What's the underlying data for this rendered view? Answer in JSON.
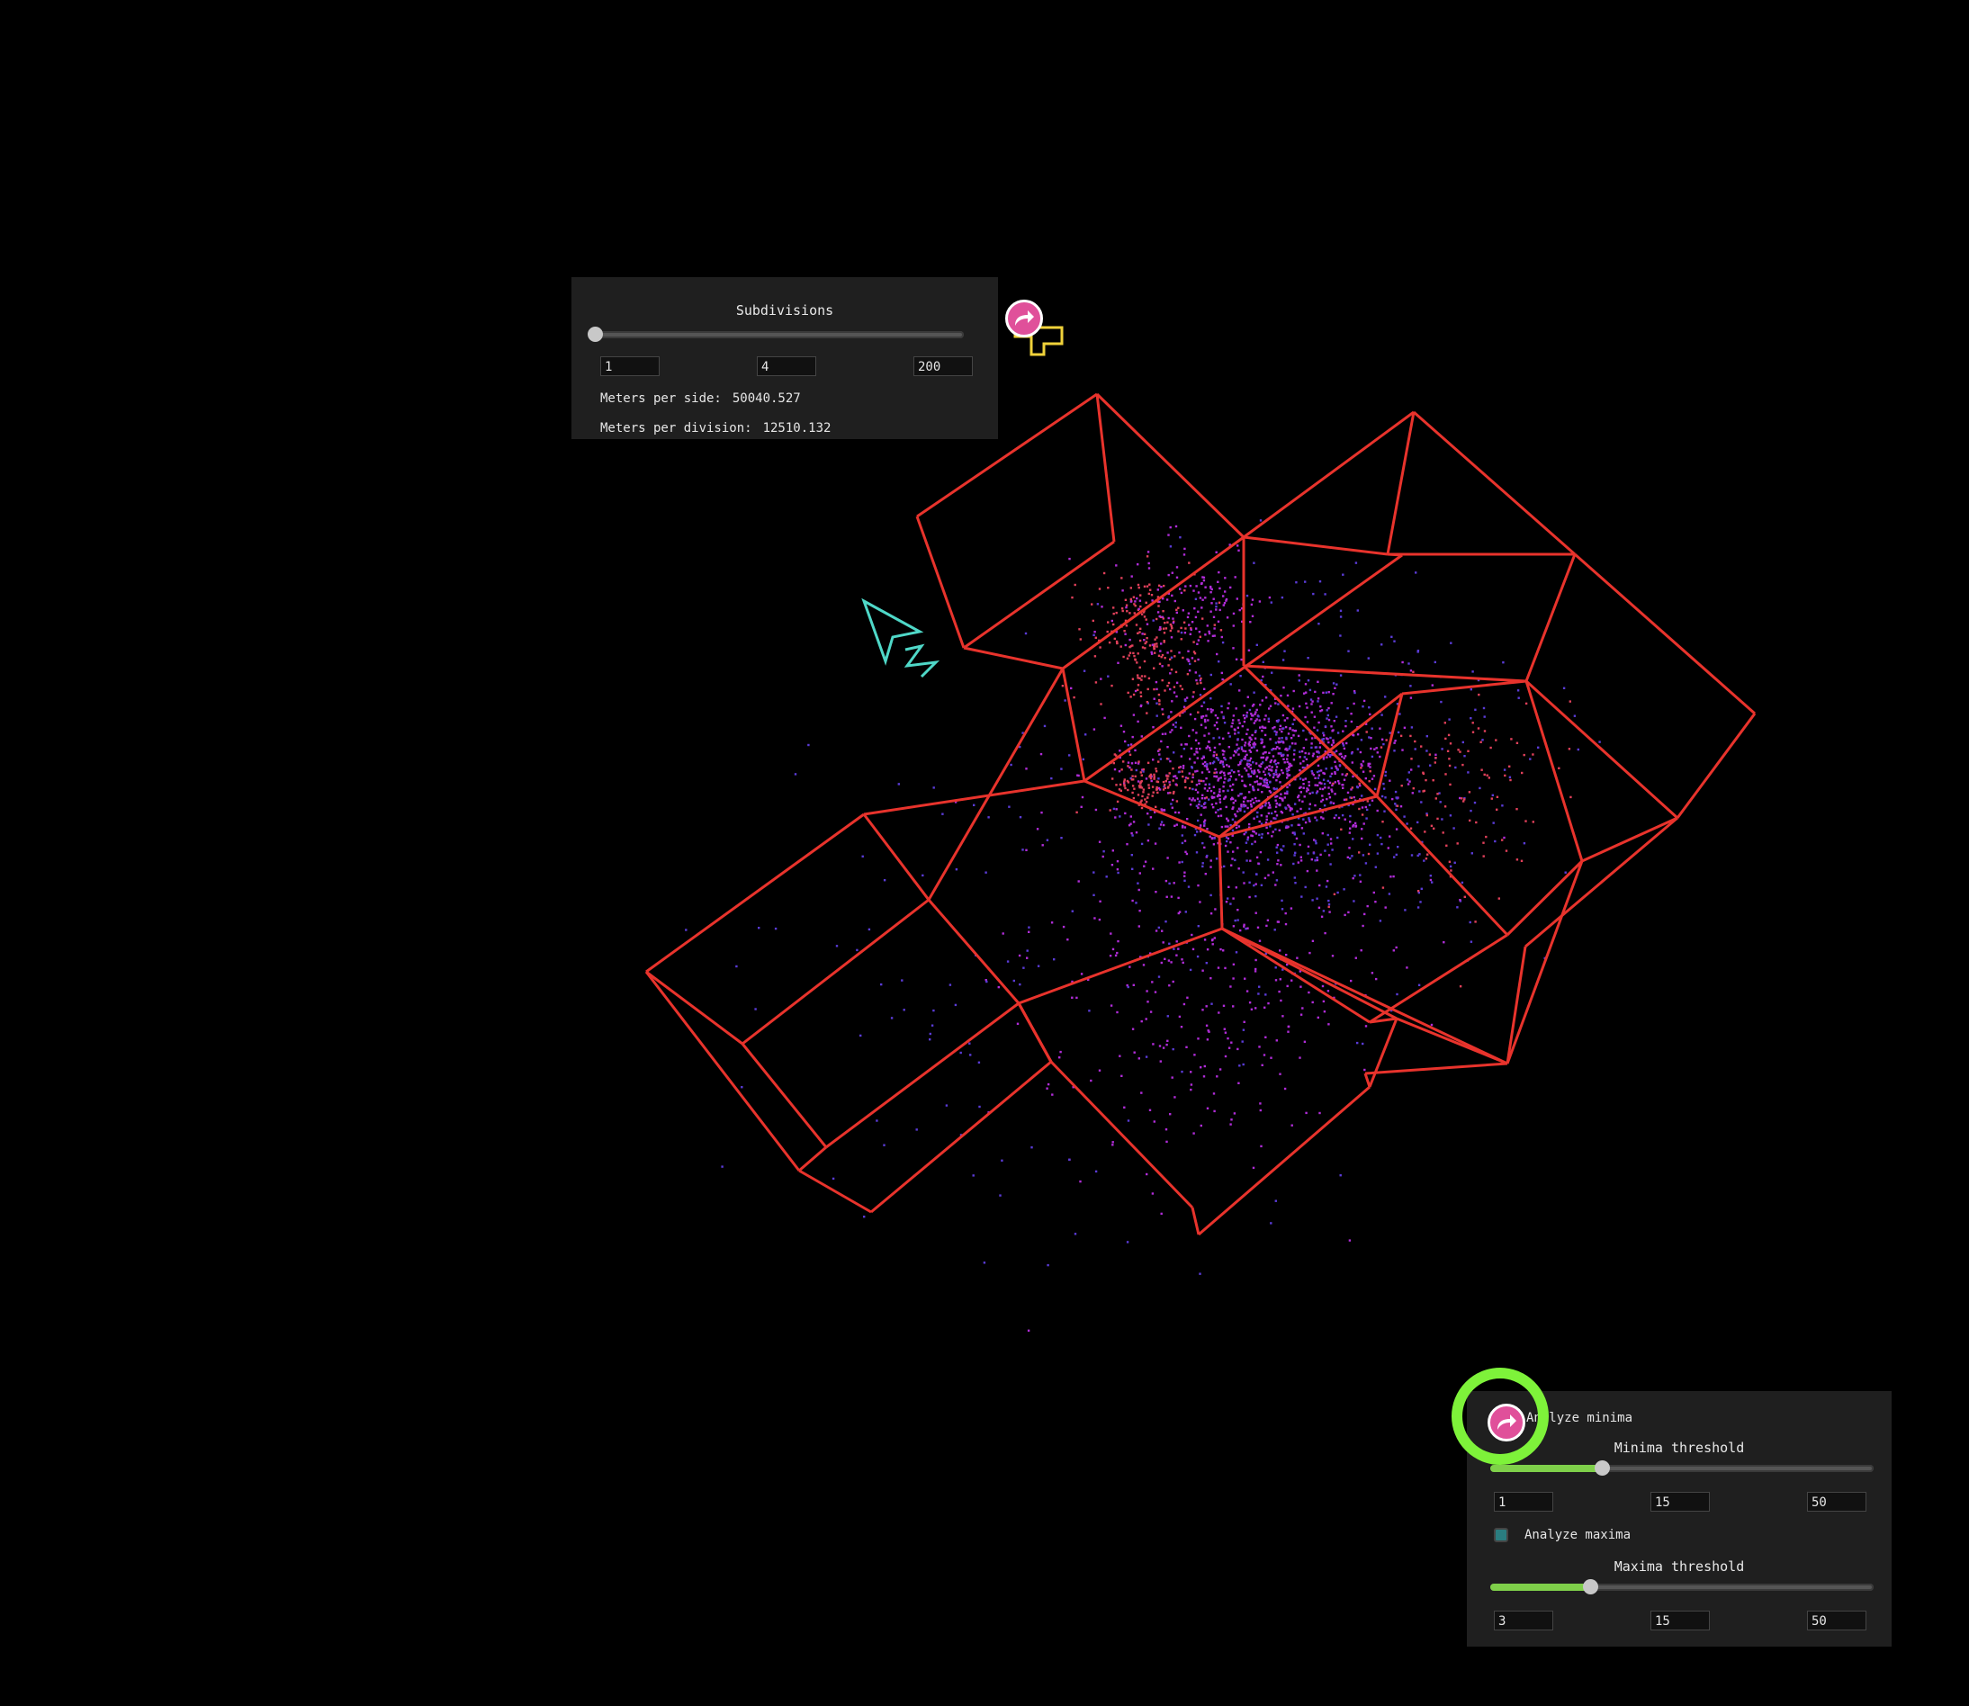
{
  "subdivisions_panel": {
    "title": "Subdivisions",
    "slider_fraction": 0.0,
    "min_value": "1",
    "current_value": "4",
    "max_value": "200",
    "meters_per_side_label": "Meters per side:",
    "meters_per_side_value": "50040.527",
    "meters_per_division_label": "Meters per division:",
    "meters_per_division_value": "12510.132"
  },
  "threshold_panel": {
    "analyze_minima_label": "Analyze minima",
    "minima_threshold_title": "Minima threshold",
    "minima_slider_fraction": 0.29,
    "minima_min": "1",
    "minima_current": "15",
    "minima_max": "50",
    "analyze_maxima_label": "Analyze maxima",
    "maxima_threshold_title": "Maxima threshold",
    "maxima_slider_fraction": 0.26,
    "maxima_min": "3",
    "maxima_current": "15",
    "maxima_max": "50"
  },
  "icons": {
    "redo_badge": "redo-arrow-icon",
    "orientation_gizmo": "north-arrow-icon",
    "cursor": "crosshair-cursor-icon"
  },
  "colors": {
    "wireframe": "#e8332c",
    "points_primary": "#b02cd8",
    "points_secondary": "#5a3bd6",
    "points_tertiary": "#e0405a",
    "gizmo": "#4fd8c8",
    "highlight_ring": "#7ef23a",
    "badge": "#e0509a"
  }
}
